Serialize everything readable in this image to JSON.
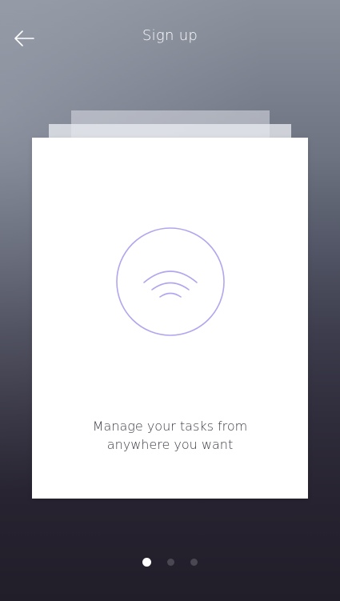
{
  "header": {
    "title": "Sign up",
    "back_icon": "arrow-left-icon"
  },
  "card": {
    "icon": "wifi-signal-icon",
    "accent_color": "#b3a5ee",
    "message_line1": "Manage your tasks from",
    "message_line2": "anywhere you want"
  },
  "pager": {
    "total_pages": 3,
    "active_page": 1
  }
}
